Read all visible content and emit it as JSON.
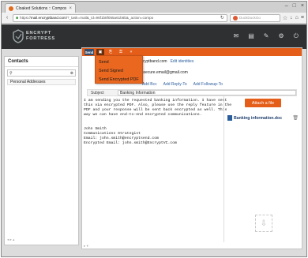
{
  "browser": {
    "tab_title": "Cloaked Solutions :: Compose",
    "url_prefix": "https://",
    "url_domain": "mail.encryptband.com",
    "url_rest": "/?_task=mail&_id=96f1b8f055a61b6b&_action=compo",
    "search_placeholder": "DuckDuckGo"
  },
  "logo": {
    "line1": "ENCRYPT",
    "line2": "FORTRESS"
  },
  "contacts": {
    "title": "Contacts",
    "address_book": "Personal Addresses"
  },
  "compose": {
    "send_label": "Send",
    "from_email": "ncryptband.com",
    "edit_identities": "Edit identities",
    "to_address": "unsecure.email@gmail.com",
    "add_cc": "Add Bcc",
    "add_reply_to": "Add Reply-To",
    "add_followup_to": "Add Followup-To",
    "subject_label": "Subject",
    "subject_value": "Banking Information"
  },
  "send_menu": {
    "items": [
      "Send",
      "Send Signed",
      "Send Encrypted PDF"
    ]
  },
  "message_body": "I am sending you the requested banking information. I have sent\nthis via encrypted PDF. Also, please use the reply feature in the\nPDF and your response will be sent back encrypted as well. This\nway we can have end-to-end encrypted communications.\n\n\nJohn Smith\nCommunications Strategist\nEmail: john.smith@encryptsend.com\nEncrypted Email: john.smith@EncryptVC.com",
  "attachments": {
    "attach_button": "Attach a file",
    "files": [
      "Banking information.doc"
    ]
  },
  "colors": {
    "accent": "#e45e1a",
    "header_bg": "#2e3031",
    "link": "#2a5d9c"
  }
}
